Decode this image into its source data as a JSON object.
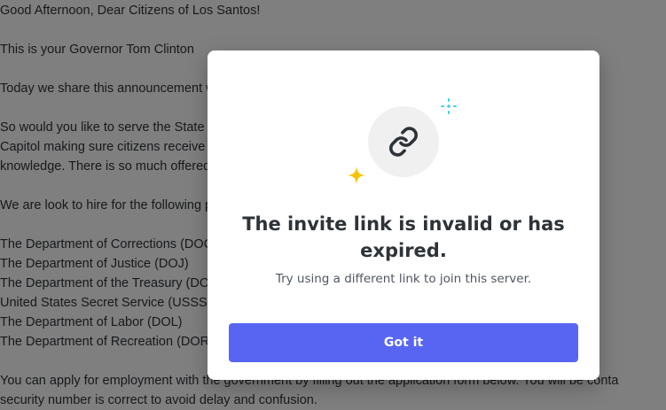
{
  "background_document": {
    "lines": [
      "Good Afternoon, Dear Citizens of Los Santos!",
      "",
      "This is your Governor Tom Clinton",
      "",
      "Today we share this announcement with you all with a wish to better serve, protect and",
      "",
      "So would you like to serve the State of San Andreas? Would you like to work for the governor",
      "Capitol making sure citizens receive the best service possible? Then join us as Government",
      "knowledge. There is so much offered to those who want to work for the State, and today",
      "",
      "We are look to hire for the following positions:",
      "",
      "The Department of Corrections (DOC)",
      "The Department of Justice (DOJ)",
      "The Department of the Treasury (DOT)",
      "United States Secret Service (USSS)",
      "The Department of Labor (DOL)",
      "The Department of Recreation (DOR)",
      "",
      "You can apply for employment with the government by filling out the application form below. You will be conta",
      "security number is correct to avoid delay and confusion."
    ]
  },
  "modal": {
    "icon": "link-icon",
    "title": "The invite link is invalid or has expired.",
    "subtitle": "Try using a different link to join this server.",
    "button_label": "Got it"
  },
  "colors": {
    "accent": "#5865f2",
    "sparkle_yellow": "#f5c400",
    "sparkle_cyan": "#3fd1e0",
    "icon_bg": "#f0f0f1"
  }
}
